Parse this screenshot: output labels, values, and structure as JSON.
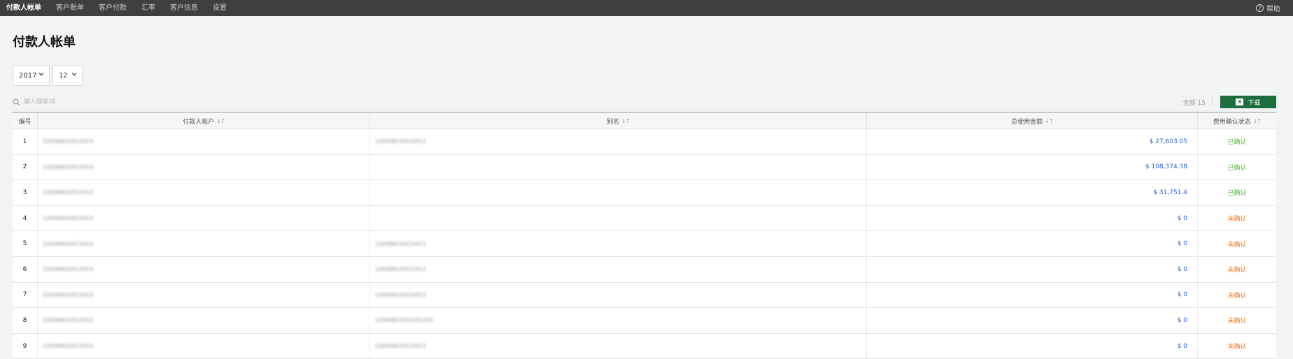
{
  "nav": {
    "items": [
      "付款人帐单",
      "客户账单",
      "客户付款",
      "汇率",
      "客户信息",
      "设置"
    ],
    "help_label": "帮助"
  },
  "page": {
    "title": "付款人帐单"
  },
  "filters": {
    "year": "2017",
    "month": "12"
  },
  "search": {
    "placeholder": "输入搜索词"
  },
  "summary": {
    "total_label": "全部 15",
    "download_label": "下载"
  },
  "table": {
    "headers": [
      "编号",
      "付款人帐户",
      "别名",
      "总使用金额",
      "费用确认状态"
    ],
    "rows": [
      {
        "no": "1",
        "account": "1009863453453",
        "alias": "1009863453453",
        "amount": "$ 27,603.05",
        "status": "已确认"
      },
      {
        "no": "2",
        "account": "1009863453453",
        "alias": "",
        "amount": "$ 108,374.38",
        "status": "已确认"
      },
      {
        "no": "3",
        "account": "1009863453453",
        "alias": "",
        "amount": "$ 31,751.4",
        "status": "已确认"
      },
      {
        "no": "4",
        "account": "1009863453453",
        "alias": "",
        "amount": "$ 0",
        "status": "未确认"
      },
      {
        "no": "5",
        "account": "1009863453453",
        "alias": "1009863453453",
        "amount": "$ 0",
        "status": "未确认"
      },
      {
        "no": "6",
        "account": "1009863453453",
        "alias": "1009863453453",
        "amount": "$ 0",
        "status": "未确认"
      },
      {
        "no": "7",
        "account": "1009863453453",
        "alias": "1009863453453",
        "amount": "$ 0",
        "status": "未确认"
      },
      {
        "no": "8",
        "account": "1009863453453",
        "alias": "100986345345345",
        "amount": "$ 0",
        "status": "未确认"
      },
      {
        "no": "9",
        "account": "1009863453453",
        "alias": "1009863453453",
        "amount": "$ 0",
        "status": "未确认"
      }
    ]
  },
  "colors": {
    "nav_bg": "#3f3f3f",
    "download_bg": "#1d6e3e",
    "amount": "#2a5fd6",
    "confirmed": "#58b946",
    "unconfirmed": "#f07a28"
  },
  "status_confirmed_value": "已确认"
}
